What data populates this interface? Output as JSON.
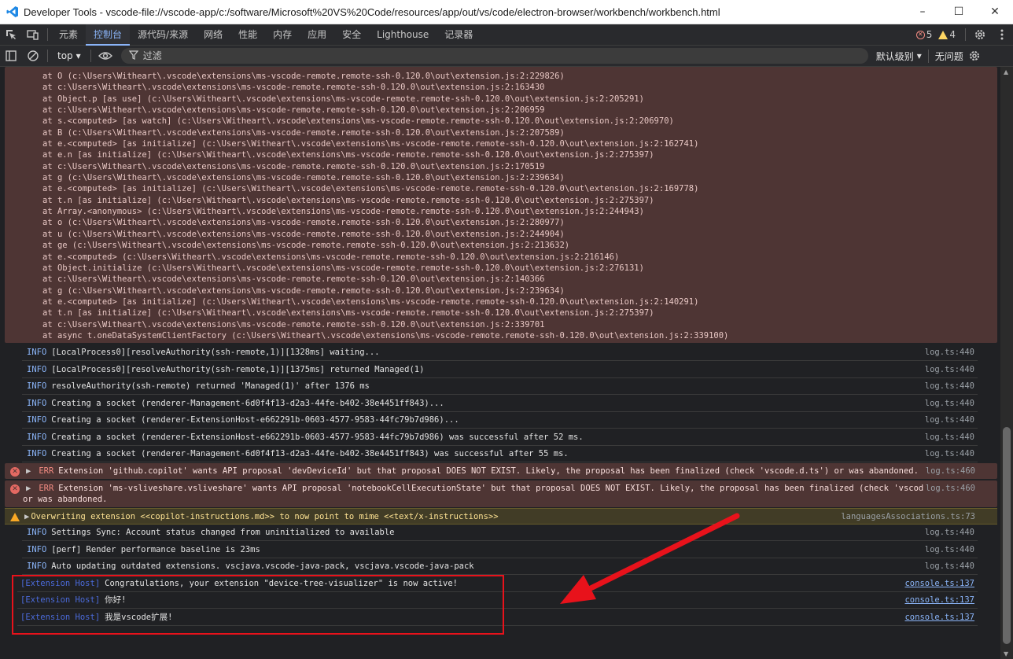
{
  "window": {
    "title": "Developer Tools - vscode-file://vscode-app/c:/software/Microsoft%20VS%20Code/resources/app/out/vs/code/electron-browser/workbench/workbench.html",
    "minimize": "–",
    "maximize": "☐",
    "close": "✕"
  },
  "tabs": [
    "元素",
    "控制台",
    "源代码/来源",
    "网络",
    "性能",
    "内存",
    "应用",
    "安全",
    "Lighthouse",
    "记录器"
  ],
  "counts": {
    "errors": "5",
    "warnings": "4"
  },
  "toolbar": {
    "context": "top",
    "filter_placeholder": "过滤",
    "levels": "默认级别",
    "issues": "无问题"
  },
  "stack_lines": [
    "at O (c:\\Users\\Witheart\\.vscode\\extensions\\ms-vscode-remote.remote-ssh-0.120.0\\out\\extension.js:2:229826)",
    "at c:\\Users\\Witheart\\.vscode\\extensions\\ms-vscode-remote.remote-ssh-0.120.0\\out\\extension.js:2:163430",
    "at Object.p [as use] (c:\\Users\\Witheart\\.vscode\\extensions\\ms-vscode-remote.remote-ssh-0.120.0\\out\\extension.js:2:205291)",
    "at c:\\Users\\Witheart\\.vscode\\extensions\\ms-vscode-remote.remote-ssh-0.120.0\\out\\extension.js:2:206959",
    "at s.<computed> [as watch] (c:\\Users\\Witheart\\.vscode\\extensions\\ms-vscode-remote.remote-ssh-0.120.0\\out\\extension.js:2:206970)",
    "at B (c:\\Users\\Witheart\\.vscode\\extensions\\ms-vscode-remote.remote-ssh-0.120.0\\out\\extension.js:2:207589)",
    "at e.<computed> [as initialize] (c:\\Users\\Witheart\\.vscode\\extensions\\ms-vscode-remote.remote-ssh-0.120.0\\out\\extension.js:2:162741)",
    "at e.n [as initialize] (c:\\Users\\Witheart\\.vscode\\extensions\\ms-vscode-remote.remote-ssh-0.120.0\\out\\extension.js:2:275397)",
    "at c:\\Users\\Witheart\\.vscode\\extensions\\ms-vscode-remote.remote-ssh-0.120.0\\out\\extension.js:2:170519",
    "at g (c:\\Users\\Witheart\\.vscode\\extensions\\ms-vscode-remote.remote-ssh-0.120.0\\out\\extension.js:2:239634)",
    "at e.<computed> [as initialize] (c:\\Users\\Witheart\\.vscode\\extensions\\ms-vscode-remote.remote-ssh-0.120.0\\out\\extension.js:2:169778)",
    "at t.n [as initialize] (c:\\Users\\Witheart\\.vscode\\extensions\\ms-vscode-remote.remote-ssh-0.120.0\\out\\extension.js:2:275397)",
    "at Array.<anonymous> (c:\\Users\\Witheart\\.vscode\\extensions\\ms-vscode-remote.remote-ssh-0.120.0\\out\\extension.js:2:244943)",
    "at o (c:\\Users\\Witheart\\.vscode\\extensions\\ms-vscode-remote.remote-ssh-0.120.0\\out\\extension.js:2:280977)",
    "at u (c:\\Users\\Witheart\\.vscode\\extensions\\ms-vscode-remote.remote-ssh-0.120.0\\out\\extension.js:2:244904)",
    "at ge (c:\\Users\\Witheart\\.vscode\\extensions\\ms-vscode-remote.remote-ssh-0.120.0\\out\\extension.js:2:213632)",
    "at e.<computed> (c:\\Users\\Witheart\\.vscode\\extensions\\ms-vscode-remote.remote-ssh-0.120.0\\out\\extension.js:2:216146)",
    "at Object.initialize (c:\\Users\\Witheart\\.vscode\\extensions\\ms-vscode-remote.remote-ssh-0.120.0\\out\\extension.js:2:276131)",
    "at c:\\Users\\Witheart\\.vscode\\extensions\\ms-vscode-remote.remote-ssh-0.120.0\\out\\extension.js:2:140366",
    "at g (c:\\Users\\Witheart\\.vscode\\extensions\\ms-vscode-remote.remote-ssh-0.120.0\\out\\extension.js:2:239634)",
    "at e.<computed> [as initialize] (c:\\Users\\Witheart\\.vscode\\extensions\\ms-vscode-remote.remote-ssh-0.120.0\\out\\extension.js:2:140291)",
    "at t.n [as initialize] (c:\\Users\\Witheart\\.vscode\\extensions\\ms-vscode-remote.remote-ssh-0.120.0\\out\\extension.js:2:275397)",
    "at c:\\Users\\Witheart\\.vscode\\extensions\\ms-vscode-remote.remote-ssh-0.120.0\\out\\extension.js:2:339701",
    "at async t.oneDataSystemClientFactory (c:\\Users\\Witheart\\.vscode\\extensions\\ms-vscode-remote.remote-ssh-0.120.0\\out\\extension.js:2:339100)"
  ],
  "info_rows": [
    {
      "level": "INFO",
      "message": "[LocalProcess0][resolveAuthority(ssh-remote,1)][1328ms] waiting...",
      "source": "log.ts:440"
    },
    {
      "level": "INFO",
      "message": "[LocalProcess0][resolveAuthority(ssh-remote,1)][1375ms] returned Managed(1)",
      "source": "log.ts:440"
    },
    {
      "level": "INFO",
      "message": "resolveAuthority(ssh-remote) returned 'Managed(1)' after 1376 ms",
      "source": "log.ts:440"
    },
    {
      "level": "INFO",
      "message": "Creating a socket (renderer-Management-6d0f4f13-d2a3-44fe-b402-38e4451ff843)...",
      "source": "log.ts:440"
    },
    {
      "level": "INFO",
      "message": "Creating a socket (renderer-ExtensionHost-e662291b-0603-4577-9583-44fc79b7d986)...",
      "source": "log.ts:440"
    },
    {
      "level": "INFO",
      "message": "Creating a socket (renderer-ExtensionHost-e662291b-0603-4577-9583-44fc79b7d986) was successful after 52 ms.",
      "source": "log.ts:440"
    },
    {
      "level": "INFO",
      "message": "Creating a socket (renderer-Management-6d0f4f13-d2a3-44fe-b402-38e4451ff843) was successful after 55 ms.",
      "source": "log.ts:440"
    }
  ],
  "error_rows": [
    {
      "level": "ERR",
      "message": "Extension 'github.copilot' wants API proposal 'devDeviceId' but that proposal DOES NOT EXIST. Likely, the proposal has been finalized (check 'vscode.d.ts') or was abandoned.",
      "source": "log.ts:460"
    },
    {
      "level": "ERR",
      "message": "Extension 'ms-vsliveshare.vsliveshare' wants API proposal 'notebookCellExecutionState' but that proposal DOES NOT EXIST. Likely, the proposal has been finalized (check 'vscode.d.ts')",
      "continuation": "or was abandoned.",
      "source": "log.ts:460"
    }
  ],
  "warn_row": {
    "message": "Overwriting extension <<copilot-instructions.md>> to now point to mime <<text/x-instructions>>",
    "source": "languagesAssociations.ts:73"
  },
  "info_rows_2": [
    {
      "level": "INFO",
      "message": "Settings Sync: Account status changed from uninitialized to available",
      "source": "log.ts:440"
    },
    {
      "level": "INFO",
      "message": "[perf] Render performance baseline is 23ms",
      "source": "log.ts:440"
    },
    {
      "level": "INFO",
      "message": "Auto updating outdated extensions. vscjava.vscode-java-pack, vscjava.vscode-java-pack",
      "source": "log.ts:440"
    }
  ],
  "ext_rows": [
    {
      "tag": "[Extension Host]",
      "message": "Congratulations, your extension \"device-tree-visualizer\" is now active!",
      "source": "console.ts:137"
    },
    {
      "tag": "[Extension Host]",
      "message": "你好!",
      "source": "console.ts:137"
    },
    {
      "tag": "[Extension Host]",
      "message": "我是vscode扩展!",
      "source": "console.ts:137"
    }
  ],
  "colors": {
    "annotation": "#e8121b",
    "accent": "#8ab4f8",
    "error_bg": "#4e3534",
    "warn_bg": "#413c26"
  }
}
